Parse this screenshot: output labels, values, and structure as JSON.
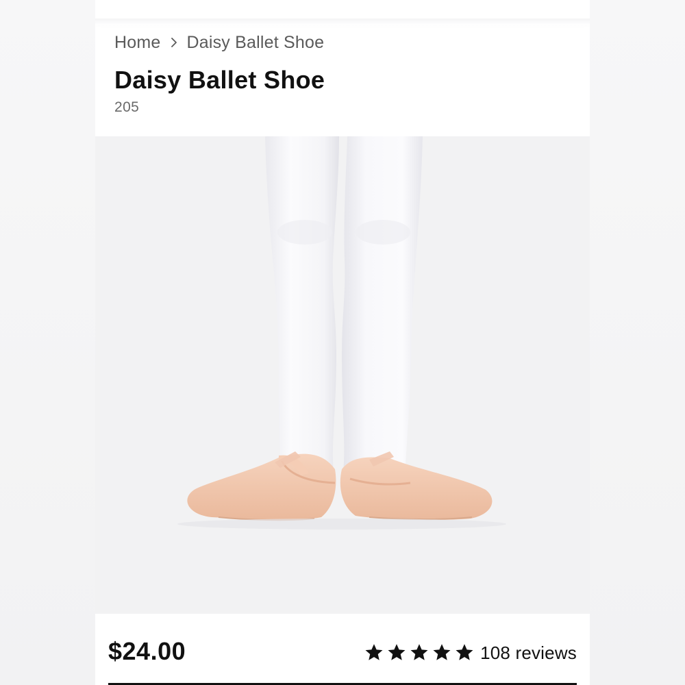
{
  "breadcrumb": {
    "home": "Home",
    "current": "Daisy Ballet Shoe"
  },
  "product": {
    "title": "Daisy Ballet Shoe",
    "sku": "205",
    "image_icon": "product-photo",
    "price": "$24.00",
    "rating": 5,
    "rating_max": 5,
    "reviews_label": "108 reviews"
  },
  "colors": {
    "text": "#111111",
    "muted": "#5a5a5a",
    "image_bg": "#f2f2f3",
    "shoe": "#f3c9ae",
    "tights": "#fbfbfc"
  }
}
